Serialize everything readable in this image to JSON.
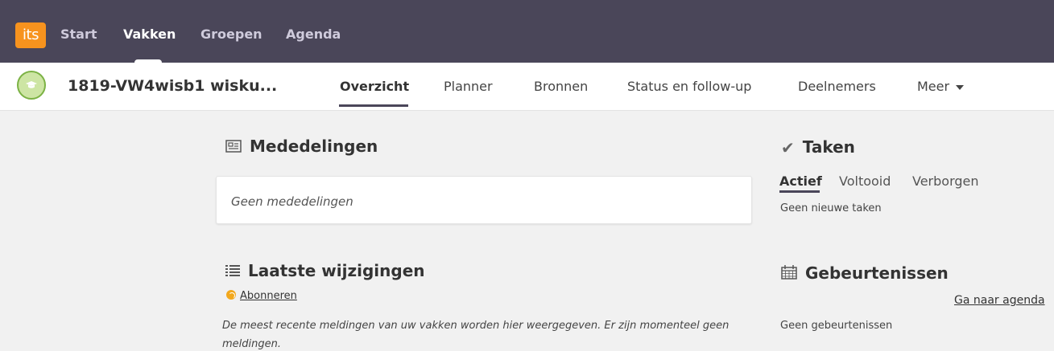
{
  "topnav": {
    "logo": "its",
    "items": [
      "Start",
      "Vakken",
      "Groepen",
      "Agenda"
    ],
    "active": "Vakken"
  },
  "course": {
    "title": "1819-VW4wisb1 wisku...",
    "tabs": [
      "Overzicht",
      "Planner",
      "Bronnen",
      "Status en follow-up",
      "Deelnemers",
      "Meer"
    ],
    "active_tab": "Overzicht"
  },
  "mededelingen": {
    "title": "Mededelingen",
    "empty": "Geen mededelingen"
  },
  "wijzigingen": {
    "title": "Laatste wijzigingen",
    "subscribe": "Abonneren",
    "description": "De meest recente meldingen van uw vakken worden hier weergegeven. Er zijn momenteel geen meldingen."
  },
  "taken": {
    "title": "Taken",
    "tabs": [
      "Actief",
      "Voltooid",
      "Verborgen"
    ],
    "active_tab": "Actief",
    "empty": "Geen nieuwe taken"
  },
  "gebeurtenissen": {
    "title": "Gebeurtenissen",
    "agenda_link": "Ga naar agenda",
    "empty": "Geen gebeurtenissen"
  },
  "colors": {
    "topbar": "#4a4659",
    "logo": "#f7931e",
    "avatar": "#cde5a4"
  }
}
